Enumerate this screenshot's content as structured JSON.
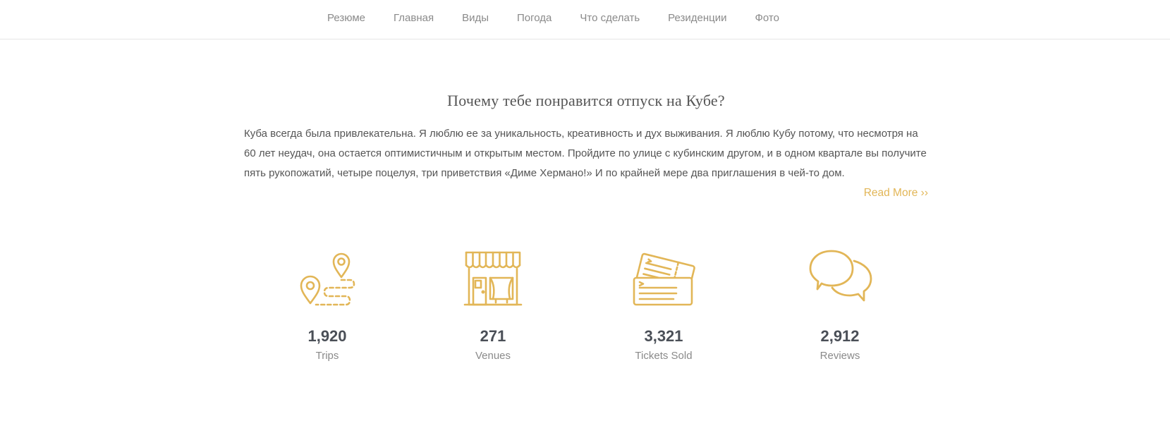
{
  "nav": {
    "items": [
      "Резюме",
      "Главная",
      "Виды",
      "Погода",
      "Что сделать",
      "Резиденции",
      "Фото"
    ]
  },
  "about": {
    "title": "Почему тебе понравится отпуск на Кубе?",
    "body": "Куба всегда была привлекательна. Я люблю ее за уникальность, креативность и дух выживания. Я люблю Кубу потому, что несмотря на 60 лет неудач, она остается оптимистичным и открытым местом. Пройдите по улице с кубинским другом, и в одном квартале вы получите пять рукопожатий, четыре поцелуя, три приветствия «Диме Хермано!» И по крайней мере два приглашения в чей-то дом.",
    "read_more": "Read More ››"
  },
  "stats": [
    {
      "value": "1,920",
      "label": "Trips",
      "icon": "map-route-icon"
    },
    {
      "value": "271",
      "label": "Venues",
      "icon": "storefront-icon"
    },
    {
      "value": "3,321",
      "label": "Tickets Sold",
      "icon": "tickets-icon"
    },
    {
      "value": "2,912",
      "label": "Reviews",
      "icon": "speech-bubbles-icon"
    }
  ],
  "colors": {
    "accent": "#e2b657",
    "text": "#555555",
    "muted": "#8a8a8a",
    "number": "#4a4f57"
  }
}
